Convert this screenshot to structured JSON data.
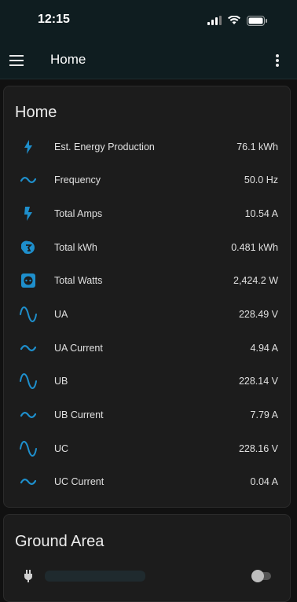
{
  "status": {
    "time": "12:15"
  },
  "appbar": {
    "title": "Home"
  },
  "home_card": {
    "title": "Home",
    "rows": [
      {
        "label": "Est. Energy Production",
        "value": "76.1 kWh",
        "icon": "flash-icon"
      },
      {
        "label": "Frequency",
        "value": "50.0 Hz",
        "icon": "sine-wave-small-icon"
      },
      {
        "label": "Total Amps",
        "value": "10.54 A",
        "icon": "current-icon"
      },
      {
        "label": "Total kWh",
        "value": "0.481 kWh",
        "icon": "meter-icon"
      },
      {
        "label": "Total Watts",
        "value": "2,424.2 W",
        "icon": "socket-icon"
      },
      {
        "label": "UA",
        "value": "228.49 V",
        "icon": "sine-wave-icon"
      },
      {
        "label": "UA Current",
        "value": "4.94 A",
        "icon": "sine-wave-small-icon"
      },
      {
        "label": "UB",
        "value": "228.14 V",
        "icon": "sine-wave-icon"
      },
      {
        "label": "UB Current",
        "value": "7.79 A",
        "icon": "sine-wave-small-icon"
      },
      {
        "label": "UC",
        "value": "228.16 V",
        "icon": "sine-wave-icon"
      },
      {
        "label": "UC Current",
        "value": "0.04 A",
        "icon": "sine-wave-small-icon"
      }
    ]
  },
  "ground_card": {
    "title": "Ground Area",
    "toggle_state": "off"
  },
  "colors": {
    "accent": "#1e8fcc",
    "background": "#111111",
    "card": "#1c1c1c"
  }
}
